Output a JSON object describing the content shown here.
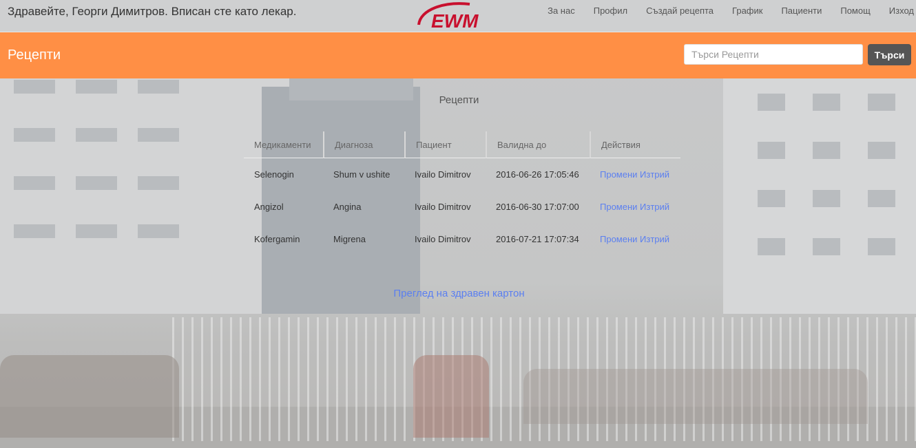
{
  "header": {
    "greeting": "Здравейте, Георги Димитров. Вписан сте като лекар.",
    "logo_text": "EWM",
    "nav": [
      "За нас",
      "Профил",
      "Създай рецепта",
      "График",
      "Пациенти",
      "Помощ",
      "Изход"
    ]
  },
  "toolbar": {
    "title": "Рецепти",
    "search_placeholder": "Търси Рецепти",
    "search_button": "Търси"
  },
  "main": {
    "title": "Рецепти",
    "columns": [
      "Медикаменти",
      "Диагноза",
      "Пациент",
      "Валидна до",
      "Действия"
    ],
    "rows": [
      {
        "medication": "Selenogin",
        "diagnosis": "Shum v ushite",
        "patient": "Ivailo Dimitrov",
        "valid_until": "2016-06-26 17:05:46",
        "edit": "Промени",
        "delete": "Изтрий"
      },
      {
        "medication": "Angizol",
        "diagnosis": "Angina",
        "patient": "Ivailo Dimitrov",
        "valid_until": "2016-06-30 17:07:00",
        "edit": "Промени",
        "delete": "Изтрий"
      },
      {
        "medication": "Kofergamin",
        "diagnosis": "Migrena",
        "patient": "Ivailo Dimitrov",
        "valid_until": "2016-07-21 17:07:34",
        "edit": "Промени",
        "delete": "Изтрий"
      }
    ],
    "health_record_link": "Преглед на здравен картон"
  },
  "colors": {
    "accent": "#ff8f45",
    "link": "#5b7ff0",
    "logo": "#c8102e"
  }
}
